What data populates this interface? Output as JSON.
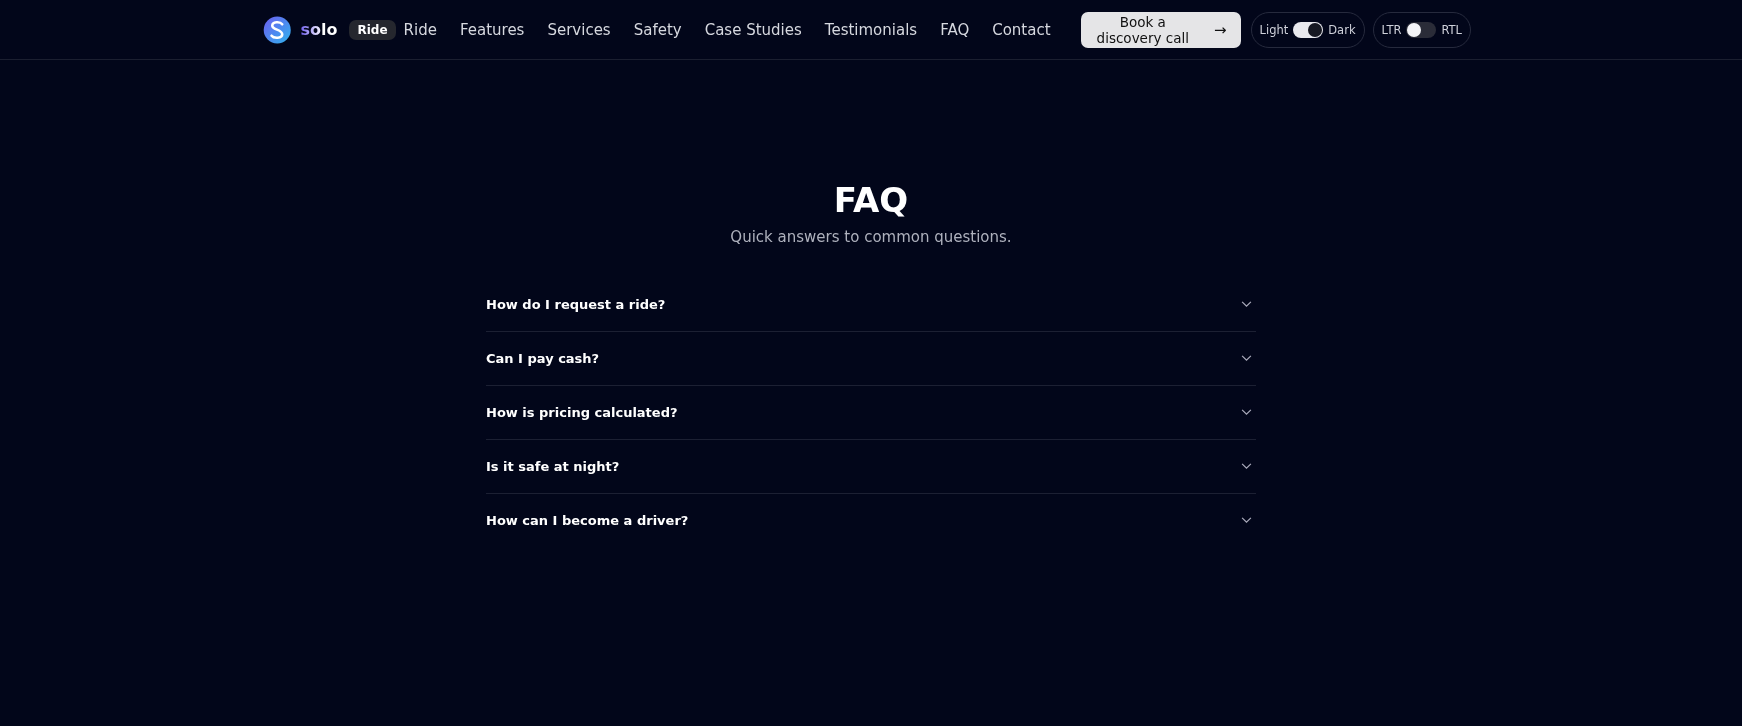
{
  "header": {
    "logo_text": "solo",
    "badge": "Ride",
    "nav": [
      {
        "label": "Ride"
      },
      {
        "label": "Features"
      },
      {
        "label": "Services"
      },
      {
        "label": "Safety"
      },
      {
        "label": "Case Studies"
      },
      {
        "label": "Testimonials"
      },
      {
        "label": "FAQ"
      },
      {
        "label": "Contact"
      }
    ],
    "cta": {
      "label": "Book a discovery call",
      "icon": "→"
    },
    "theme_toggle": {
      "left": "Light",
      "right": "Dark",
      "on": true
    },
    "direction_toggle": {
      "left": "LTR",
      "right": "RTL",
      "on": false
    }
  },
  "faq": {
    "title": "FAQ",
    "subtitle": "Quick answers to common questions.",
    "items": [
      {
        "question": "How do I request a ride?",
        "expanded": false
      },
      {
        "question": "Can I pay cash?",
        "expanded": false
      },
      {
        "question": "How is pricing calculated?",
        "expanded": false
      },
      {
        "question": "Is it safe at night?",
        "expanded": false
      },
      {
        "question": "How can I become a driver?",
        "expanded": false
      }
    ]
  }
}
